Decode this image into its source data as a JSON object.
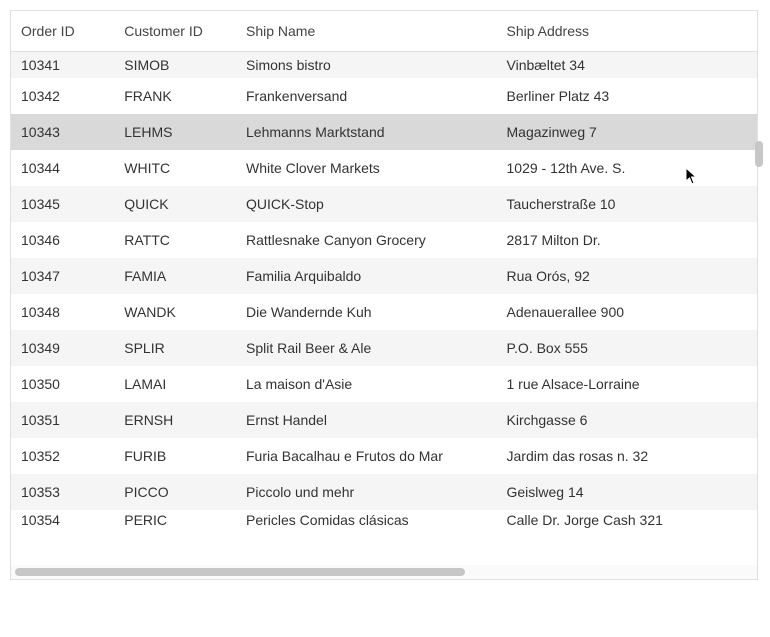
{
  "columns": {
    "order_id": "Order ID",
    "customer_id": "Customer ID",
    "ship_name": "Ship Name",
    "ship_address": "Ship Address"
  },
  "hovered_index": 2,
  "rows": [
    {
      "order_id": "10341",
      "customer_id": "SIMOB",
      "ship_name": "Simons bistro",
      "ship_address": "Vinbæltet 34"
    },
    {
      "order_id": "10342",
      "customer_id": "FRANK",
      "ship_name": "Frankenversand",
      "ship_address": "Berliner Platz 43"
    },
    {
      "order_id": "10343",
      "customer_id": "LEHMS",
      "ship_name": "Lehmanns Marktstand",
      "ship_address": "Magazinweg 7"
    },
    {
      "order_id": "10344",
      "customer_id": "WHITC",
      "ship_name": "White Clover Markets",
      "ship_address": "1029 - 12th Ave. S."
    },
    {
      "order_id": "10345",
      "customer_id": "QUICK",
      "ship_name": "QUICK-Stop",
      "ship_address": "Taucherstraße 10"
    },
    {
      "order_id": "10346",
      "customer_id": "RATTC",
      "ship_name": "Rattlesnake Canyon Grocery",
      "ship_address": "2817 Milton Dr."
    },
    {
      "order_id": "10347",
      "customer_id": "FAMIA",
      "ship_name": "Familia Arquibaldo",
      "ship_address": "Rua Orós, 92"
    },
    {
      "order_id": "10348",
      "customer_id": "WANDK",
      "ship_name": "Die Wandernde Kuh",
      "ship_address": "Adenauerallee 900"
    },
    {
      "order_id": "10349",
      "customer_id": "SPLIR",
      "ship_name": "Split Rail Beer & Ale",
      "ship_address": "P.O. Box 555"
    },
    {
      "order_id": "10350",
      "customer_id": "LAMAI",
      "ship_name": "La maison d'Asie",
      "ship_address": "1 rue Alsace-Lorraine"
    },
    {
      "order_id": "10351",
      "customer_id": "ERNSH",
      "ship_name": "Ernst Handel",
      "ship_address": "Kirchgasse 6"
    },
    {
      "order_id": "10352",
      "customer_id": "FURIB",
      "ship_name": "Furia Bacalhau e Frutos do Mar",
      "ship_address": "Jardim das rosas n. 32"
    },
    {
      "order_id": "10353",
      "customer_id": "PICCO",
      "ship_name": "Piccolo und mehr",
      "ship_address": "Geislweg 14"
    },
    {
      "order_id": "10354",
      "customer_id": "PERIC",
      "ship_name": "Pericles Comidas clásicas",
      "ship_address": "Calle Dr. Jorge Cash 321"
    }
  ]
}
